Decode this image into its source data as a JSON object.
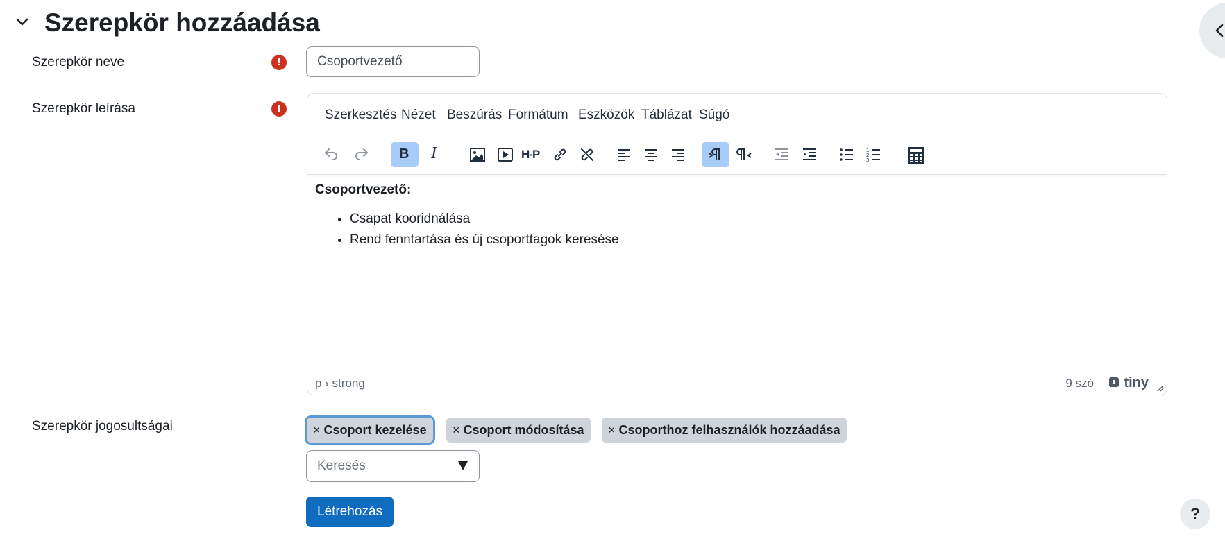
{
  "section": {
    "title": "Szerepkör hozzáadása"
  },
  "fields": {
    "name_label": "Szerepkör neve",
    "name_value": "Csoportvezető",
    "description_label": "Szerepkör leírása",
    "permissions_label": "Szerepkör jogosultságai"
  },
  "editor": {
    "menu": [
      "Szerkesztés",
      "Nézet",
      "Beszúrás",
      "Formátum",
      "Eszközök",
      "Táblázat",
      "Súgó"
    ],
    "toolbar_icons": [
      "undo-icon",
      "redo-icon",
      "bold-icon",
      "italic-icon",
      "image-icon",
      "media-icon",
      "h5p-icon",
      "link-icon",
      "unlink-icon",
      "align-left-icon",
      "align-center-icon",
      "align-right-icon",
      "ltr-icon",
      "rtl-icon",
      "outdent-icon",
      "indent-icon",
      "bullet-list-icon",
      "numbered-list-icon",
      "calculator-icon"
    ],
    "bold_glyph": "B",
    "italic_glyph": "I",
    "h5p_glyph": "H-P",
    "content_heading": "Csoportvezető:",
    "content_items": [
      "Csapat kooridnálása",
      "Rend fenntartása és új csoporttagok keresése"
    ],
    "path": "p › strong",
    "word_count": "9 szó",
    "brand": "tiny"
  },
  "permissions": {
    "remove_glyph": "×",
    "tags": [
      "Csoport kezelése",
      "Csoport módosítása",
      "Csoporthoz felhasználók hozzáadása"
    ],
    "search_placeholder": "Keresés"
  },
  "actions": {
    "create_label": "Létrehozás",
    "help_glyph": "?"
  },
  "colors": {
    "primary": "#0f6cbf",
    "required": "#ca3120",
    "active_toolbar": "#a6ccf7",
    "tag_bg": "#ced4da"
  }
}
